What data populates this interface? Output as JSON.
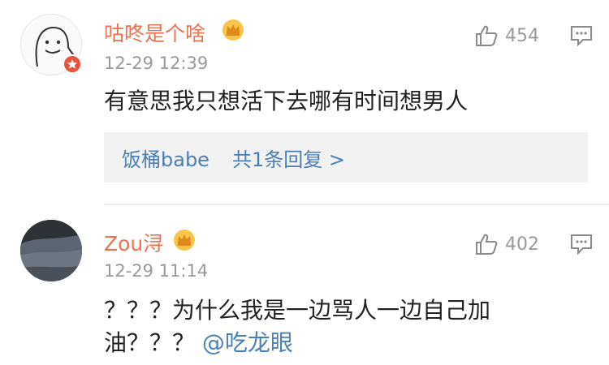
{
  "comments": [
    {
      "username": "咕咚是个啥",
      "time": "12-29 12:39",
      "text_line1": "有意思我只想活下去哪有时间想男人",
      "likes": "454",
      "reply_preview": {
        "name": "饭桶babe",
        "summary": "共1条回复 >"
      }
    },
    {
      "username": "Zou浔",
      "time": "12-29 11:14",
      "text_line1": "？？？为什么我是一边骂人一边自己加",
      "text_line2": "油？？？",
      "mention": "@吃龙眼",
      "likes": "402"
    }
  ],
  "colors": {
    "username": "#eb7350",
    "link": "#4a7fb8",
    "meta": "#9a9a9a",
    "reply_bg": "#f2f2f2"
  },
  "icons": [
    "thumbs-up-icon",
    "comment-reply-icon",
    "vip-crown-icon",
    "verified-badge-icon"
  ]
}
